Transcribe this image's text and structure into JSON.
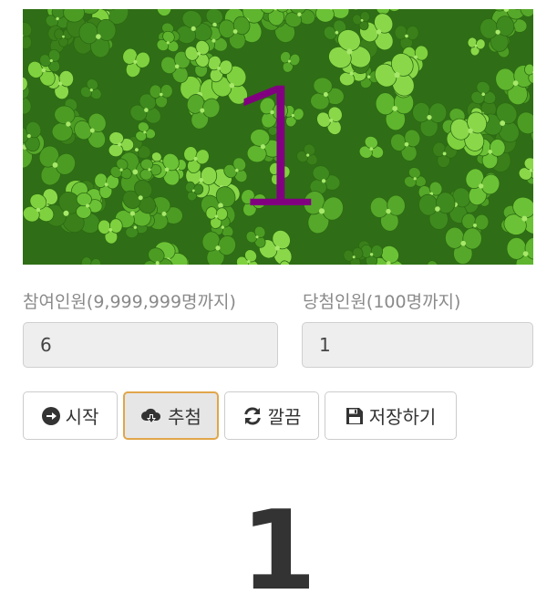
{
  "banner": {
    "number": "1",
    "number_color": "#800080"
  },
  "participants": {
    "label": "참여인원(9,999,999명까지)",
    "value": "6"
  },
  "winners": {
    "label": "당첨인원(100명까지)",
    "value": "1"
  },
  "buttons": {
    "start": {
      "label": "시작",
      "icon": "arrow-circle-right-icon"
    },
    "draw": {
      "label": "추첨",
      "icon": "cloud-download-icon"
    },
    "clear": {
      "label": "깔끔",
      "icon": "refresh-icon"
    },
    "save": {
      "label": "저장하기",
      "icon": "floppy-disk-icon"
    }
  },
  "result": {
    "number": "1"
  },
  "colors": {
    "accent_border": "#e0a64a",
    "clover_green": "#4f9a2a"
  }
}
